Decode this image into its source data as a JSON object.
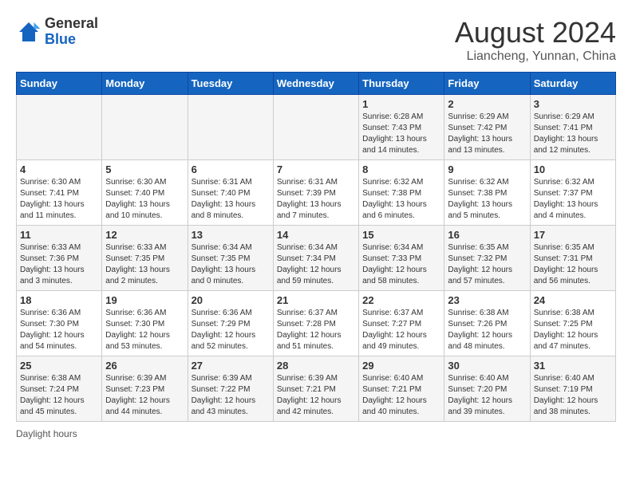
{
  "header": {
    "logo_general": "General",
    "logo_blue": "Blue",
    "main_title": "August 2024",
    "sub_title": "Liancheng, Yunnan, China"
  },
  "days_of_week": [
    "Sunday",
    "Monday",
    "Tuesday",
    "Wednesday",
    "Thursday",
    "Friday",
    "Saturday"
  ],
  "weeks": [
    [
      {
        "day": "",
        "info": ""
      },
      {
        "day": "",
        "info": ""
      },
      {
        "day": "",
        "info": ""
      },
      {
        "day": "",
        "info": ""
      },
      {
        "day": "1",
        "info": "Sunrise: 6:28 AM\nSunset: 7:43 PM\nDaylight: 13 hours and 14 minutes."
      },
      {
        "day": "2",
        "info": "Sunrise: 6:29 AM\nSunset: 7:42 PM\nDaylight: 13 hours and 13 minutes."
      },
      {
        "day": "3",
        "info": "Sunrise: 6:29 AM\nSunset: 7:41 PM\nDaylight: 13 hours and 12 minutes."
      }
    ],
    [
      {
        "day": "4",
        "info": "Sunrise: 6:30 AM\nSunset: 7:41 PM\nDaylight: 13 hours and 11 minutes."
      },
      {
        "day": "5",
        "info": "Sunrise: 6:30 AM\nSunset: 7:40 PM\nDaylight: 13 hours and 10 minutes."
      },
      {
        "day": "6",
        "info": "Sunrise: 6:31 AM\nSunset: 7:40 PM\nDaylight: 13 hours and 8 minutes."
      },
      {
        "day": "7",
        "info": "Sunrise: 6:31 AM\nSunset: 7:39 PM\nDaylight: 13 hours and 7 minutes."
      },
      {
        "day": "8",
        "info": "Sunrise: 6:32 AM\nSunset: 7:38 PM\nDaylight: 13 hours and 6 minutes."
      },
      {
        "day": "9",
        "info": "Sunrise: 6:32 AM\nSunset: 7:38 PM\nDaylight: 13 hours and 5 minutes."
      },
      {
        "day": "10",
        "info": "Sunrise: 6:32 AM\nSunset: 7:37 PM\nDaylight: 13 hours and 4 minutes."
      }
    ],
    [
      {
        "day": "11",
        "info": "Sunrise: 6:33 AM\nSunset: 7:36 PM\nDaylight: 13 hours and 3 minutes."
      },
      {
        "day": "12",
        "info": "Sunrise: 6:33 AM\nSunset: 7:35 PM\nDaylight: 13 hours and 2 minutes."
      },
      {
        "day": "13",
        "info": "Sunrise: 6:34 AM\nSunset: 7:35 PM\nDaylight: 13 hours and 0 minutes."
      },
      {
        "day": "14",
        "info": "Sunrise: 6:34 AM\nSunset: 7:34 PM\nDaylight: 12 hours and 59 minutes."
      },
      {
        "day": "15",
        "info": "Sunrise: 6:34 AM\nSunset: 7:33 PM\nDaylight: 12 hours and 58 minutes."
      },
      {
        "day": "16",
        "info": "Sunrise: 6:35 AM\nSunset: 7:32 PM\nDaylight: 12 hours and 57 minutes."
      },
      {
        "day": "17",
        "info": "Sunrise: 6:35 AM\nSunset: 7:31 PM\nDaylight: 12 hours and 56 minutes."
      }
    ],
    [
      {
        "day": "18",
        "info": "Sunrise: 6:36 AM\nSunset: 7:30 PM\nDaylight: 12 hours and 54 minutes."
      },
      {
        "day": "19",
        "info": "Sunrise: 6:36 AM\nSunset: 7:30 PM\nDaylight: 12 hours and 53 minutes."
      },
      {
        "day": "20",
        "info": "Sunrise: 6:36 AM\nSunset: 7:29 PM\nDaylight: 12 hours and 52 minutes."
      },
      {
        "day": "21",
        "info": "Sunrise: 6:37 AM\nSunset: 7:28 PM\nDaylight: 12 hours and 51 minutes."
      },
      {
        "day": "22",
        "info": "Sunrise: 6:37 AM\nSunset: 7:27 PM\nDaylight: 12 hours and 49 minutes."
      },
      {
        "day": "23",
        "info": "Sunrise: 6:38 AM\nSunset: 7:26 PM\nDaylight: 12 hours and 48 minutes."
      },
      {
        "day": "24",
        "info": "Sunrise: 6:38 AM\nSunset: 7:25 PM\nDaylight: 12 hours and 47 minutes."
      }
    ],
    [
      {
        "day": "25",
        "info": "Sunrise: 6:38 AM\nSunset: 7:24 PM\nDaylight: 12 hours and 45 minutes."
      },
      {
        "day": "26",
        "info": "Sunrise: 6:39 AM\nSunset: 7:23 PM\nDaylight: 12 hours and 44 minutes."
      },
      {
        "day": "27",
        "info": "Sunrise: 6:39 AM\nSunset: 7:22 PM\nDaylight: 12 hours and 43 minutes."
      },
      {
        "day": "28",
        "info": "Sunrise: 6:39 AM\nSunset: 7:21 PM\nDaylight: 12 hours and 42 minutes."
      },
      {
        "day": "29",
        "info": "Sunrise: 6:40 AM\nSunset: 7:21 PM\nDaylight: 12 hours and 40 minutes."
      },
      {
        "day": "30",
        "info": "Sunrise: 6:40 AM\nSunset: 7:20 PM\nDaylight: 12 hours and 39 minutes."
      },
      {
        "day": "31",
        "info": "Sunrise: 6:40 AM\nSunset: 7:19 PM\nDaylight: 12 hours and 38 minutes."
      }
    ]
  ],
  "footer": {
    "daylight_label": "Daylight hours"
  }
}
